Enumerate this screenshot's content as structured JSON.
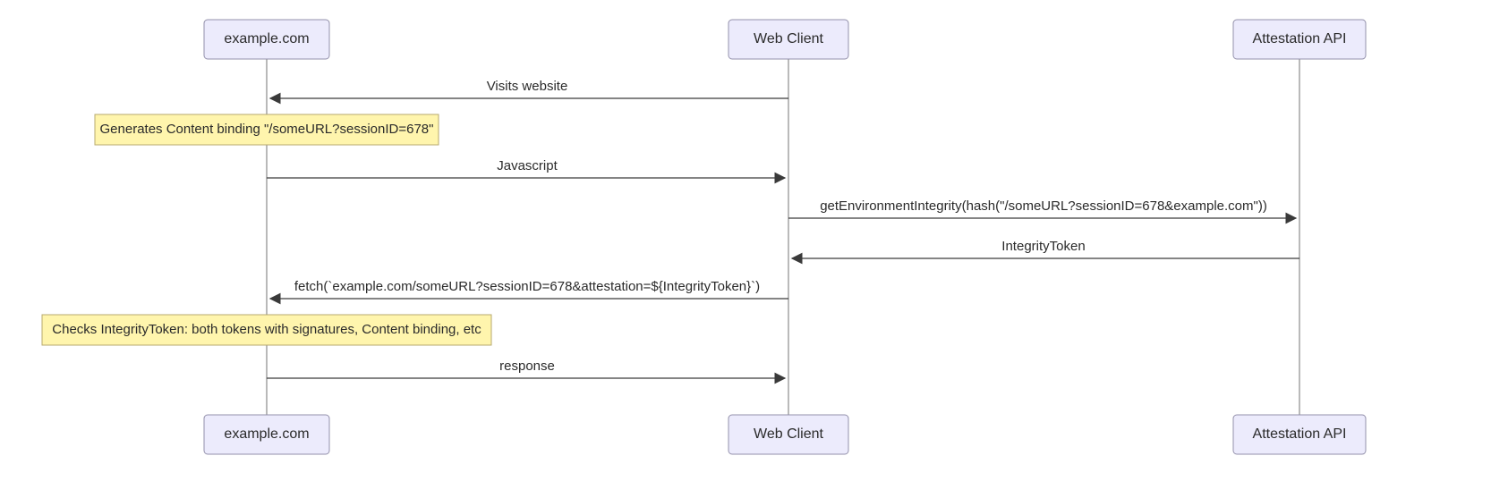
{
  "participants": {
    "example": "example.com",
    "client": "Web Client",
    "attest": "Attestation API"
  },
  "messages": {
    "m1": "Visits website",
    "m2": "Javascript",
    "m3": "getEnvironmentIntegrity(hash(\"/someURL?sessionID=678&example.com\"))",
    "m4": "IntegrityToken",
    "m5": "fetch(`example.com/someURL?sessionID=678&attestation=${IntegrityToken}`)",
    "m6": "response"
  },
  "notes": {
    "n1": "Generates Content binding \"/someURL?sessionID=678\"",
    "n2": "Checks IntegrityToken: both tokens with signatures, Content binding, etc"
  },
  "chart_data": {
    "type": "sequence-diagram",
    "participants": [
      "example.com",
      "Web Client",
      "Attestation API"
    ],
    "interactions": [
      {
        "from": "Web Client",
        "to": "example.com",
        "kind": "message",
        "label": "Visits website"
      },
      {
        "at": "example.com",
        "kind": "note",
        "label": "Generates Content binding \"/someURL?sessionID=678\""
      },
      {
        "from": "example.com",
        "to": "Web Client",
        "kind": "message",
        "label": "Javascript"
      },
      {
        "from": "Web Client",
        "to": "Attestation API",
        "kind": "message",
        "label": "getEnvironmentIntegrity(hash(\"/someURL?sessionID=678&example.com\"))"
      },
      {
        "from": "Attestation API",
        "to": "Web Client",
        "kind": "message",
        "label": "IntegrityToken"
      },
      {
        "from": "Web Client",
        "to": "example.com",
        "kind": "message",
        "label": "fetch(`example.com/someURL?sessionID=678&attestation=${IntegrityToken}`)"
      },
      {
        "at": "example.com",
        "kind": "note",
        "label": "Checks IntegrityToken: both tokens with signatures, Content binding, etc"
      },
      {
        "from": "example.com",
        "to": "Web Client",
        "kind": "message",
        "label": "response"
      }
    ]
  }
}
